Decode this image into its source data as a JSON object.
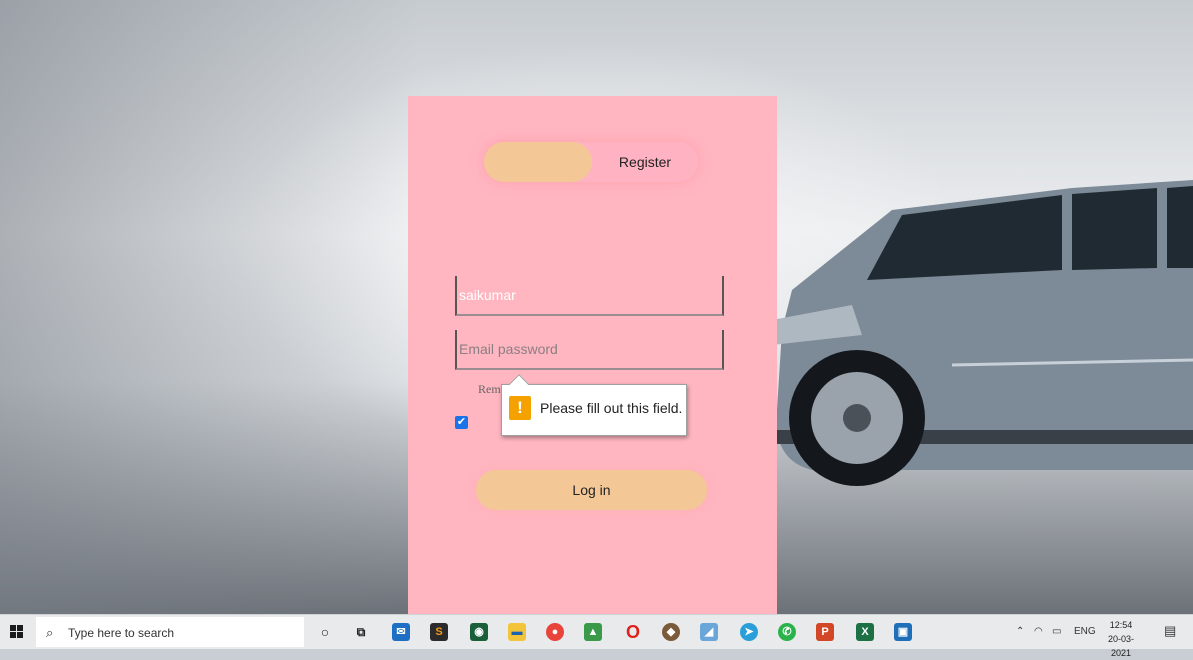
{
  "login_form": {
    "tab_register_label": "Register",
    "username_value": "saikumar",
    "password_placeholder": "Email password",
    "remember_label": "Rem",
    "login_button_label": "Log in",
    "remember_checked": true
  },
  "validation_tooltip": {
    "icon": "exclamation-icon",
    "message": "Please fill out this field."
  },
  "taskbar": {
    "search_placeholder": "Type here to search",
    "language": "ENG",
    "time": "12:54",
    "date": "20-03-2021",
    "pinned_apps": [
      "cortana",
      "task-view",
      "mail",
      "sublime",
      "camera",
      "file-explorer",
      "chrome",
      "photos",
      "opera",
      "game",
      "azure",
      "telegram",
      "whatsapp",
      "powerpoint",
      "excel",
      "photos-app"
    ]
  },
  "colors": {
    "panel": "#ffb6c1",
    "accent": "#f3c896",
    "tooltip_warning": "#f5a100"
  }
}
